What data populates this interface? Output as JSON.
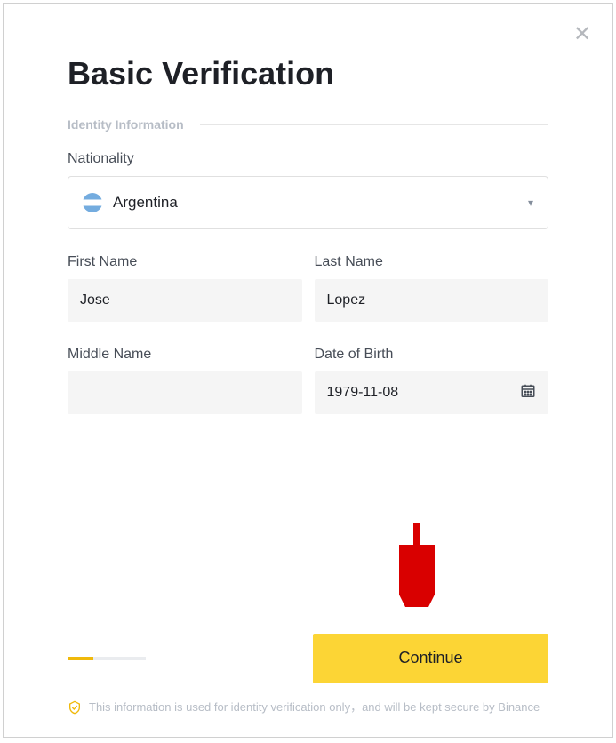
{
  "title": "Basic Verification",
  "section_label": "Identity Information",
  "nationality": {
    "label": "Nationality",
    "value": "Argentina"
  },
  "first_name": {
    "label": "First Name",
    "value": "Jose"
  },
  "last_name": {
    "label": "Last Name",
    "value": "Lopez"
  },
  "middle_name": {
    "label": "Middle Name",
    "value": ""
  },
  "dob": {
    "label": "Date of Birth",
    "value": "1979-11-08"
  },
  "continue_label": "Continue",
  "disclaimer": "This information is used for identity verification only，and will be kept secure by Binance"
}
